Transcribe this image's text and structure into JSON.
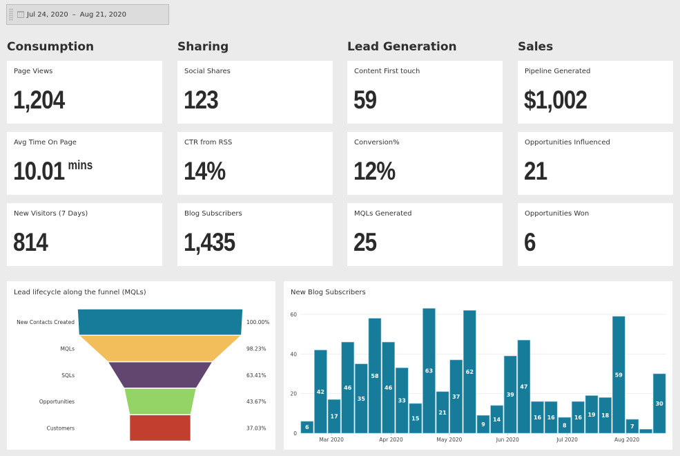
{
  "date_range": {
    "start": "Jul 24, 2020",
    "separator": "–",
    "end": "Aug 21, 2020",
    "icon": "calendar-icon"
  },
  "columns": [
    {
      "title": "Consumption",
      "cards": [
        {
          "label": "Page Views",
          "value": "1,204",
          "unit": ""
        },
        {
          "label": "Avg Time On Page",
          "value": "10.01",
          "unit": "mins"
        },
        {
          "label": "New Visitors (7 Days)",
          "value": "814",
          "unit": ""
        }
      ]
    },
    {
      "title": "Sharing",
      "cards": [
        {
          "label": "Social Shares",
          "value": "123",
          "unit": ""
        },
        {
          "label": "CTR from RSS",
          "value": "14%",
          "unit": ""
        },
        {
          "label": "Blog Subscribers",
          "value": "1,435",
          "unit": ""
        }
      ]
    },
    {
      "title": "Lead Generation",
      "cards": [
        {
          "label": "Content First touch",
          "value": "59",
          "unit": ""
        },
        {
          "label": "Conversion%",
          "value": "12%",
          "unit": ""
        },
        {
          "label": "MQLs Generated",
          "value": "25",
          "unit": ""
        }
      ]
    },
    {
      "title": "Sales",
      "cards": [
        {
          "label": "Pipeline Generated",
          "value": "$1,002",
          "unit": ""
        },
        {
          "label": "Opportunities Influenced",
          "value": "21",
          "unit": ""
        },
        {
          "label": "Opportunities Won",
          "value": "6",
          "unit": ""
        }
      ]
    }
  ],
  "chart_data": [
    {
      "type": "funnel",
      "title": "Lead lifecycle along the funnel (MQLs)",
      "categories": [
        "New Contacts Created",
        "MQLs",
        "SQLs",
        "Opportunities",
        "Customers"
      ],
      "values": [
        100.0,
        98.23,
        63.41,
        43.67,
        37.03
      ],
      "value_labels": [
        "100.00%",
        "98.23%",
        "63.41%",
        "43.67%",
        "37.03%"
      ],
      "colors": [
        "#177c9a",
        "#f2be5c",
        "#624670",
        "#94d366",
        "#c23f2f"
      ]
    },
    {
      "type": "bar",
      "title": "New Blog Subscribers",
      "values": [
        6,
        42,
        17,
        46,
        35,
        58,
        46,
        33,
        15,
        63,
        21,
        37,
        62,
        9,
        14,
        39,
        47,
        16,
        16,
        8,
        16,
        19,
        18,
        59,
        7,
        2,
        30
      ],
      "data_labels": [
        "6",
        "42",
        "17",
        "46",
        "35",
        "58",
        "46",
        "33",
        "15",
        "63",
        "21",
        "37",
        "62",
        "9",
        "14",
        "39",
        "47",
        "16",
        "16",
        "8",
        "16",
        "19",
        "18",
        "59",
        "7",
        "",
        "30"
      ],
      "x_ticks": [
        {
          "label": "Mar 2020",
          "at_bar": 2.3
        },
        {
          "label": "Apr 2020",
          "at_bar": 6.7
        },
        {
          "label": "May 2020",
          "at_bar": 11.0
        },
        {
          "label": "Jun 2020",
          "at_bar": 15.3
        },
        {
          "label": "Jul 2020",
          "at_bar": 19.7
        },
        {
          "label": "Aug 2020",
          "at_bar": 24.1
        }
      ],
      "y_ticks": [
        0,
        20,
        40,
        60
      ],
      "ylim": [
        0,
        60
      ],
      "grid": true,
      "bar_color": "#177c9a",
      "xlabel": "",
      "ylabel": ""
    }
  ]
}
